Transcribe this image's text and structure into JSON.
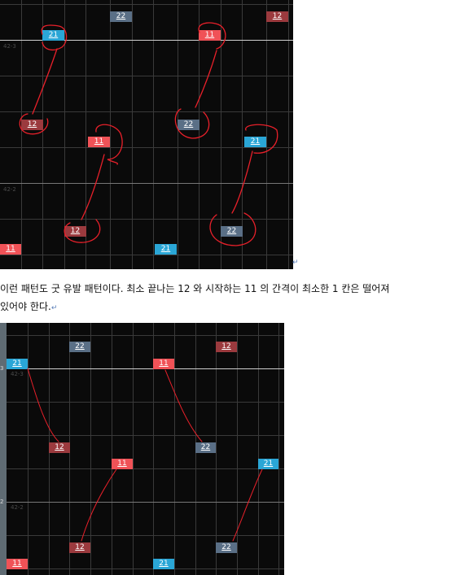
{
  "screenshot1": {
    "bar_labels": [
      "42-3",
      "42-2"
    ],
    "notes": [
      {
        "label": "22",
        "kind": "n22"
      },
      {
        "label": "12",
        "kind": "n12"
      },
      {
        "label": "21",
        "kind": "n21"
      },
      {
        "label": "11",
        "kind": "n11"
      },
      {
        "label": "12",
        "kind": "n12"
      },
      {
        "label": "22",
        "kind": "n22"
      },
      {
        "label": "11",
        "kind": "n11"
      },
      {
        "label": "21",
        "kind": "n21"
      },
      {
        "label": "12",
        "kind": "n12"
      },
      {
        "label": "22",
        "kind": "n22"
      },
      {
        "label": "11",
        "kind": "n11"
      },
      {
        "label": "21",
        "kind": "n21"
      }
    ],
    "annotation_color": "#e8202a"
  },
  "text": {
    "line1": "이런 패턴도 굿 유발 패턴이다. 최소 끝나는 12 와 시작하는 11 의 간격이 최소한 1 칸은 떨어져",
    "line2": "있어야 한다."
  },
  "screenshot2": {
    "bar_labels": [
      "42-3",
      "42-2"
    ],
    "edge_ticks": [
      "3",
      "2"
    ],
    "notes": [
      {
        "label": "22",
        "kind": "n22"
      },
      {
        "label": "12",
        "kind": "n12"
      },
      {
        "label": "21",
        "kind": "n21"
      },
      {
        "label": "11",
        "kind": "n11"
      },
      {
        "label": "12",
        "kind": "n12"
      },
      {
        "label": "22",
        "kind": "n22"
      },
      {
        "label": "11",
        "kind": "n11"
      },
      {
        "label": "21",
        "kind": "n21"
      },
      {
        "label": "12",
        "kind": "n12"
      },
      {
        "label": "22",
        "kind": "n22"
      },
      {
        "label": "11",
        "kind": "n11"
      },
      {
        "label": "21",
        "kind": "n21"
      }
    ],
    "link_color": "#e8202a"
  },
  "colors": {
    "note_21": "#2aa6d6",
    "note_11": "#f05257",
    "note_12": "#9b3a3e",
    "note_22": "#5a6f86",
    "background": "#0a0a0a"
  }
}
